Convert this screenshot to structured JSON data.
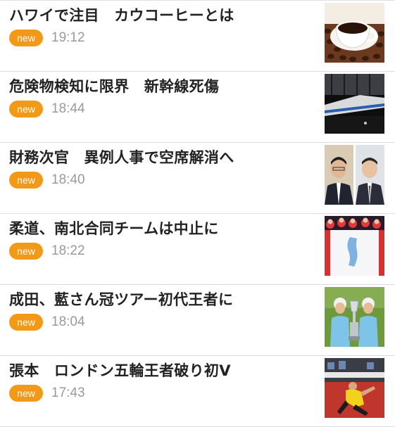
{
  "colors": {
    "badge": "#f29a17",
    "title": "#222222",
    "time": "#9a9a9a",
    "divider": "#dcdcdc"
  },
  "articles": [
    {
      "title": "ハワイで注目　カウコーヒーとは",
      "badge": "new",
      "time": "19:12",
      "thumbnail": "coffee-cup-photo"
    },
    {
      "title": "危険物検知に限界　新幹線死傷",
      "badge": "new",
      "time": "18:44",
      "thumbnail": "shinkansen-station-photo"
    },
    {
      "title": "財務次官　異例人事で空席解消へ",
      "badge": "new",
      "time": "18:40",
      "thumbnail": "officials-portraits-photo"
    },
    {
      "title": "柔道、南北合同チームは中止に",
      "badge": "new",
      "time": "18:22",
      "thumbnail": "unification-flag-team-photo"
    },
    {
      "title": "成田、藍さん冠ツアー初代王者に",
      "badge": "new",
      "time": "18:04",
      "thumbnail": "golf-trophy-photo"
    },
    {
      "title": "張本　ロンドン五輪王者破り初V",
      "badge": "new",
      "time": "17:43",
      "thumbnail": "table-tennis-photo"
    }
  ]
}
